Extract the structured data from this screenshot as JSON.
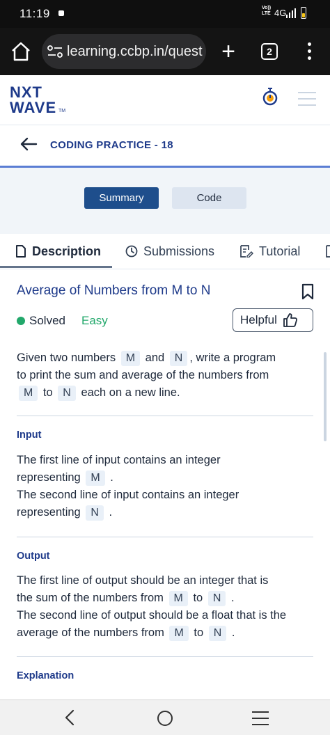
{
  "status_bar": {
    "time": "11:19",
    "network_top": "Vo))",
    "network_bottom": "LTE",
    "network": "4G"
  },
  "browser": {
    "url": "learning.ccbp.in/quest",
    "tab_count": "2",
    "new_tab_label": "+"
  },
  "app": {
    "logo_line1": "NXT",
    "logo_line2": "WAVE",
    "logo_tm": "TM",
    "brand_color": "#1e3a8a"
  },
  "header": {
    "title": "CODING PRACTICE - 18"
  },
  "toggle": {
    "summary": "Summary",
    "code": "Code",
    "active": "Summary"
  },
  "tabs": [
    {
      "label": "Description",
      "active": true
    },
    {
      "label": "Submissions",
      "active": false
    },
    {
      "label": "Tutorial",
      "active": false
    }
  ],
  "question": {
    "title": "Average of Numbers from M to N",
    "status": "Solved",
    "difficulty": "Easy",
    "helpful_label": "Helpful",
    "status_color": "#22a86b"
  },
  "description": {
    "t1": "Given two numbers",
    "c1": "M",
    "t2": "and",
    "c2": "N",
    "t3": ", write a program",
    "t4": "to print the sum and average of the numbers from",
    "c3": "M",
    "t5": "to",
    "c4": "N",
    "t6": "each on a new line."
  },
  "input_section": {
    "heading": "Input",
    "t1": "The first line of input contains an integer",
    "t2": "representing",
    "c1": "M",
    "p1": ".",
    "t3": "The second line of input contains an integer",
    "t4": "representing",
    "c2": "N",
    "p2": "."
  },
  "output_section": {
    "heading": "Output",
    "t1": "The first line of output should be an integer that is",
    "t2": "the sum of the numbers from",
    "c1": "M",
    "t3": "to",
    "c2": "N",
    "p1": ".",
    "t4": "The second line of output should be a float that is the",
    "t5": "average of the numbers from",
    "c3": "M",
    "t6": "to",
    "c4": "N",
    "p2": "."
  },
  "explanation_section": {
    "heading": "Explanation"
  }
}
